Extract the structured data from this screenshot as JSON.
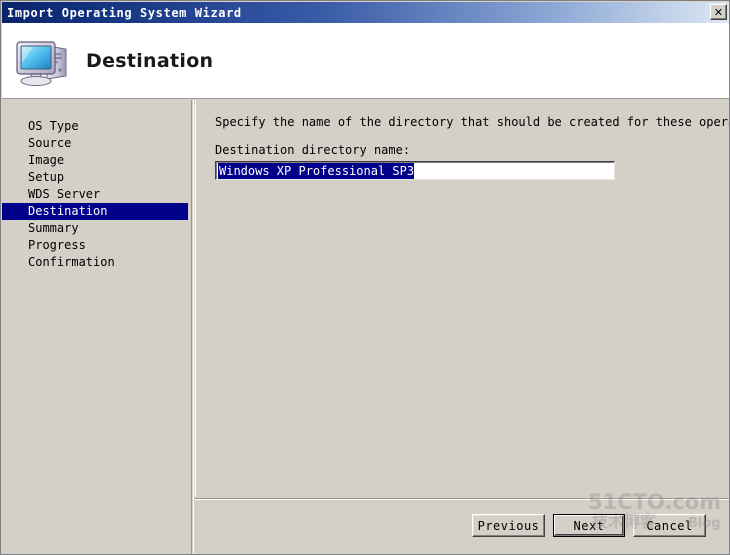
{
  "window": {
    "title": "Import Operating System Wizard",
    "close_label": "✕"
  },
  "header": {
    "title": "Destination",
    "icon": "computer-icon"
  },
  "sidebar": {
    "selected": "Destination",
    "items": [
      {
        "label": "OS Type"
      },
      {
        "label": "Source"
      },
      {
        "label": "Image"
      },
      {
        "label": "Setup"
      },
      {
        "label": "WDS Server"
      },
      {
        "label": "Destination"
      },
      {
        "label": "Summary"
      },
      {
        "label": "Progress"
      },
      {
        "label": "Confirmation"
      }
    ]
  },
  "main": {
    "instruction": "Specify the name of the directory that should be created for these operating system fi",
    "field_label": "Destination directory name:",
    "directory_value": "Windows XP Professional SP3",
    "directory_placeholder": "Destination directory name"
  },
  "footer": {
    "previous_label": "Previous",
    "next_label": "Next",
    "cancel_label": "Cancel"
  },
  "watermark": {
    "primary": "51CTO.com",
    "secondary": "Blog",
    "chinese": "技术博客"
  },
  "colors": {
    "titlebar_start": "#0a246a",
    "titlebar_end": "#dfe7f3",
    "window_face": "#d4d0c8",
    "selection": "#00008b",
    "header_bg": "#ffffff"
  }
}
